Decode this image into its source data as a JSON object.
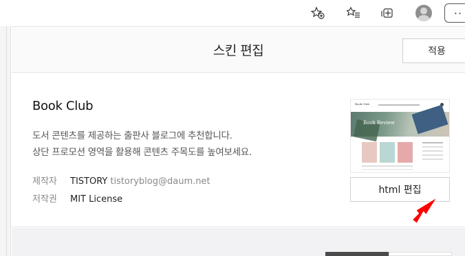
{
  "header": {
    "title": "스킨 편집",
    "apply_label": "적용"
  },
  "skin": {
    "name": "Book Club",
    "description_line1": "도서 콘텐츠를 제공하는 출판사 블로그에 추천합니다.",
    "description_line2": "상단 프로모션 영역을 활용해 콘텐츠 주목도를 높여보세요.",
    "maker_label": "제작자",
    "maker_name": "TISTORY",
    "maker_email": "tistoryblog@daum.net",
    "license_label": "저작권",
    "license_value": "MIT License",
    "html_edit_label": "html 편집"
  },
  "thumbnail": {
    "logo_text": "Book Club",
    "hero_text": "Book Review"
  },
  "colors": {
    "arrow": "#ff0000",
    "header_bg": "#fafafb",
    "bottom_bg": "#f2f2f4"
  },
  "icons": {
    "favorites": "favorites-add-icon",
    "collections": "collections-icon",
    "extensions": "extensions-icon",
    "profile": "profile-avatar-icon",
    "more": "more-icon"
  }
}
